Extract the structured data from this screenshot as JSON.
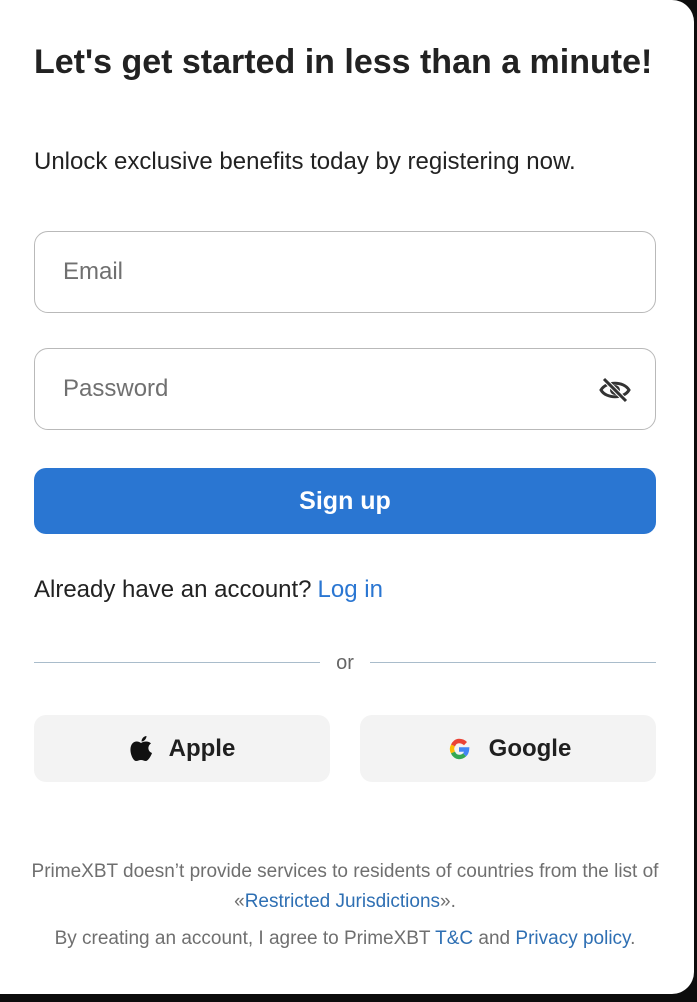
{
  "header": {
    "title": "Let's get started in less than a minute!",
    "subtitle": "Unlock exclusive benefits today by registering now."
  },
  "form": {
    "email_placeholder": "Email",
    "password_placeholder": "Password",
    "signup_label": "Sign up"
  },
  "login": {
    "prompt": "Already have an account?",
    "link": "Log in"
  },
  "divider": {
    "text": "or"
  },
  "social": {
    "apple_label": "Apple",
    "google_label": "Google"
  },
  "footer": {
    "restriction_prefix": "PrimeXBT doesn’t provide services to residents of countries from the list of «",
    "restriction_link": "Restricted Jurisdictions",
    "restriction_suffix": "».",
    "agree_prefix": "By creating an account, I agree to PrimeXBT ",
    "tc_link": "T&C",
    "agree_middle": " and ",
    "privacy_link": "Privacy policy",
    "agree_suffix": "."
  },
  "colors": {
    "accent": "#2a76d2",
    "divider": "#a9bccb",
    "social_bg": "#f3f3f3"
  },
  "icons": {
    "password_toggle": "eye-slash-icon",
    "apple": "apple-logo-icon",
    "google": "google-logo-icon"
  }
}
